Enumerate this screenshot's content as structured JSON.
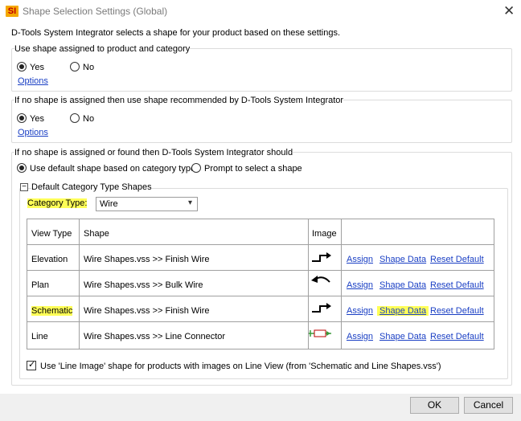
{
  "window": {
    "title": "Shape Selection Settings (Global)",
    "icon_text": "SI",
    "close_glyph": "✕"
  },
  "intro": "D-Tools System Integrator selects a shape for your product based on these settings.",
  "section1": {
    "title": "Use shape assigned to product and category",
    "yes": "Yes",
    "no": "No",
    "options": "Options"
  },
  "section2": {
    "title": "If no shape is assigned then use shape recommended by D-Tools System Integrator",
    "yes": "Yes",
    "no": "No",
    "options": "Options"
  },
  "section3": {
    "title": "If no shape is assigned or found then D-Tools System Integrator should",
    "opt_default": "Use default shape based on category type",
    "opt_prompt": "Prompt to select a shape",
    "subgroup_title": "Default Category Type Shapes",
    "collapse_glyph": "−",
    "category_label": "Category Type:",
    "category_value": "Wire",
    "dropdown_glyph": "▾",
    "table": {
      "headers": {
        "view_type": "View Type",
        "shape": "Shape",
        "image": "Image"
      },
      "rows": [
        {
          "view_type": "Elevation",
          "shape": "Wire Shapes.vss >> Finish Wire",
          "assign": "Assign",
          "shape_data": "Shape Data",
          "reset": "Reset Default"
        },
        {
          "view_type": "Plan",
          "shape": "Wire Shapes.vss >> Bulk Wire",
          "assign": "Assign",
          "shape_data": "Shape Data",
          "reset": "Reset Default"
        },
        {
          "view_type": "Schematic",
          "shape": "Wire Shapes.vss >> Finish Wire",
          "assign": "Assign",
          "shape_data": "Shape Data",
          "reset": "Reset Default"
        },
        {
          "view_type": "Line",
          "shape": "Wire Shapes.vss >> Line Connector",
          "assign": "Assign",
          "shape_data": "Shape Data",
          "reset": "Reset Default"
        }
      ]
    },
    "line_image_checkbox": "Use 'Line Image' shape for products with images on Line View (from 'Schematic and Line Shapes.vss')"
  },
  "buttons": {
    "ok": "OK",
    "cancel": "Cancel"
  },
  "colors": {
    "highlight": "#ffff57",
    "link": "#1a3fc4",
    "app_icon": "#f5a800"
  }
}
